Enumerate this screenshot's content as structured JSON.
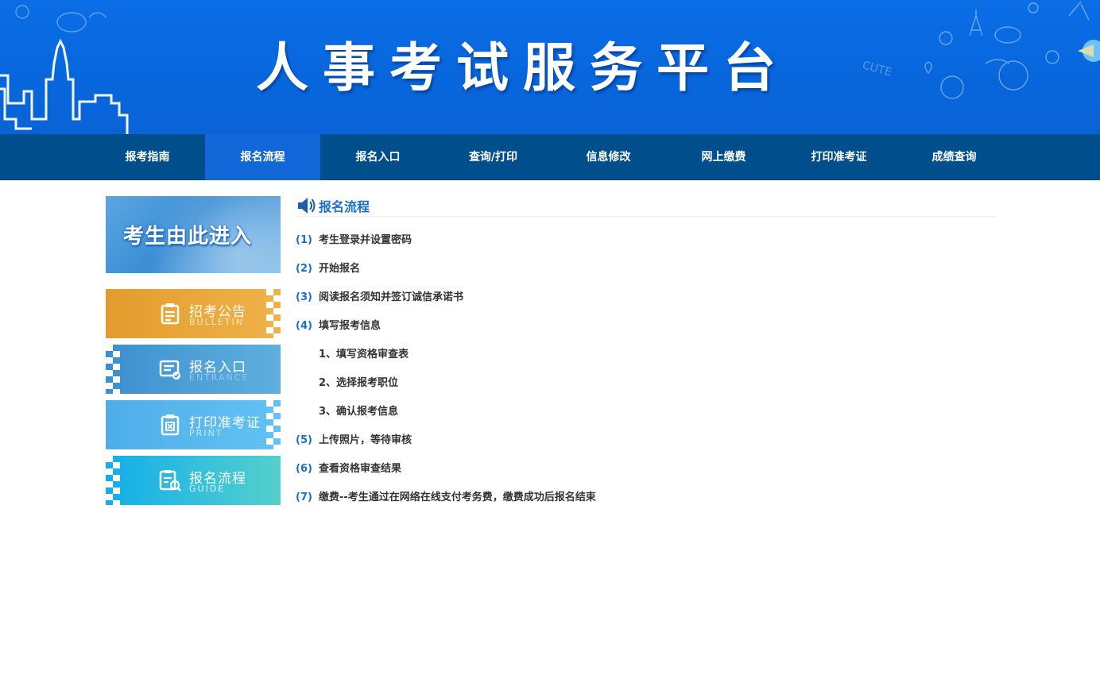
{
  "banner": {
    "title": "人事考试服务平台"
  },
  "nav": {
    "items": [
      {
        "label": "报考指南",
        "active": false
      },
      {
        "label": "报名流程",
        "active": true
      },
      {
        "label": "报名入口",
        "active": false
      },
      {
        "label": "查询/打印",
        "active": false
      },
      {
        "label": "信息修改",
        "active": false
      },
      {
        "label": "网上缴费",
        "active": false
      },
      {
        "label": "打印准考证",
        "active": false
      },
      {
        "label": "成绩查询",
        "active": false
      }
    ]
  },
  "sidebar": {
    "enter_banner": "考生由此进入",
    "buttons": [
      {
        "label": "招考公告",
        "sub": "BULLETIN",
        "color": "#e9a233",
        "icon": "document-list-icon"
      },
      {
        "label": "报名入口",
        "sub": "ENTRANCE",
        "color": "#4aa0d6",
        "icon": "registration-card-icon"
      },
      {
        "label": "打印准考证",
        "sub": "PRINT",
        "color": "#55b5ee",
        "icon": "admission-ticket-icon"
      },
      {
        "label": "报名流程",
        "sub": "GUIDE",
        "color": "#22b4e6",
        "icon": "guide-search-icon"
      }
    ]
  },
  "main": {
    "title": "报名流程",
    "steps": [
      {
        "num": "(1)",
        "text": "考生登录并设置密码"
      },
      {
        "num": "(2)",
        "text": "开始报名"
      },
      {
        "num": "(3)",
        "text": "阅读报名须知并签订诚信承诺书"
      },
      {
        "num": "(4)",
        "text": "填写报考信息"
      },
      {
        "num": "",
        "text": "1、填写资格审查表"
      },
      {
        "num": "",
        "text": "2、选择报考职位"
      },
      {
        "num": "",
        "text": "3、确认报考信息"
      },
      {
        "num": "(5)",
        "text": "上传照片，等待审核"
      },
      {
        "num": "(6)",
        "text": "查看资格审查结果"
      },
      {
        "num": "(7)",
        "text": "缴费--考生通过在网络在线支付考务费，缴费成功后报名结束"
      }
    ]
  },
  "colors": {
    "nav_bg": "#004f8c",
    "nav_active": "#1166d8",
    "accent": "#1a6fc9"
  }
}
